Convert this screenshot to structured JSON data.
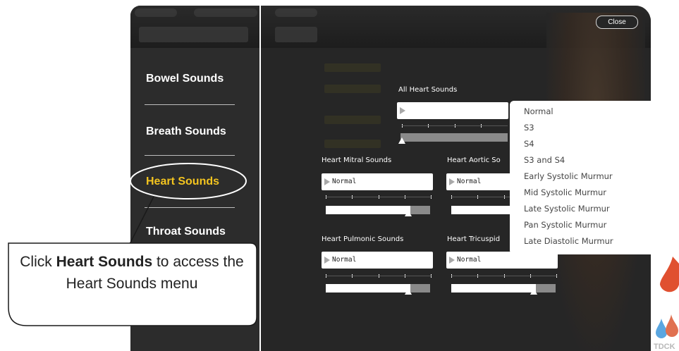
{
  "app": {
    "close_label": "Close"
  },
  "sidebar": {
    "items": [
      {
        "label": "Bowel Sounds"
      },
      {
        "label": "Breath Sounds"
      },
      {
        "label": "Heart Sounds",
        "active": true
      },
      {
        "label": "Throat Sounds"
      }
    ]
  },
  "panel": {
    "all_heart": {
      "label": "All Heart Sounds",
      "value": ""
    },
    "mitral": {
      "label": "Heart Mitral Sounds",
      "value": "Normal",
      "level": 0.78
    },
    "aortic": {
      "label": "Heart Aortic So",
      "value": "Normal"
    },
    "pulmonic": {
      "label": "Heart Pulmonic Sounds",
      "value": "Normal",
      "level": 0.78
    },
    "tricuspid": {
      "label": "Heart Tricuspid",
      "value": "Normal",
      "level": 0.78
    }
  },
  "dropdown": {
    "options": [
      "Normal",
      "S3",
      "S4",
      "S3 and S4",
      "Early Systolic Murmur",
      "Mid Systolic Murmur",
      "Late Systolic Murmur",
      "Pan Systolic Murmur",
      "Late Diastolic Murmur"
    ]
  },
  "callout": {
    "prefix": "Click ",
    "bold": "Heart Sounds",
    "suffix": " to access the Heart Sounds menu"
  },
  "logo": {
    "text": "TDCK"
  },
  "colors": {
    "accent": "#f3c41f",
    "panel_bg": "#262626",
    "sidebar_bg": "#2c2c2c",
    "drop_red": "#e05030",
    "drop_blue": "#5aa6e0"
  },
  "icons": {
    "select_arrow": "play-triangle-icon",
    "drops": [
      "blood-drop-icon",
      "water-drop-icon"
    ]
  }
}
